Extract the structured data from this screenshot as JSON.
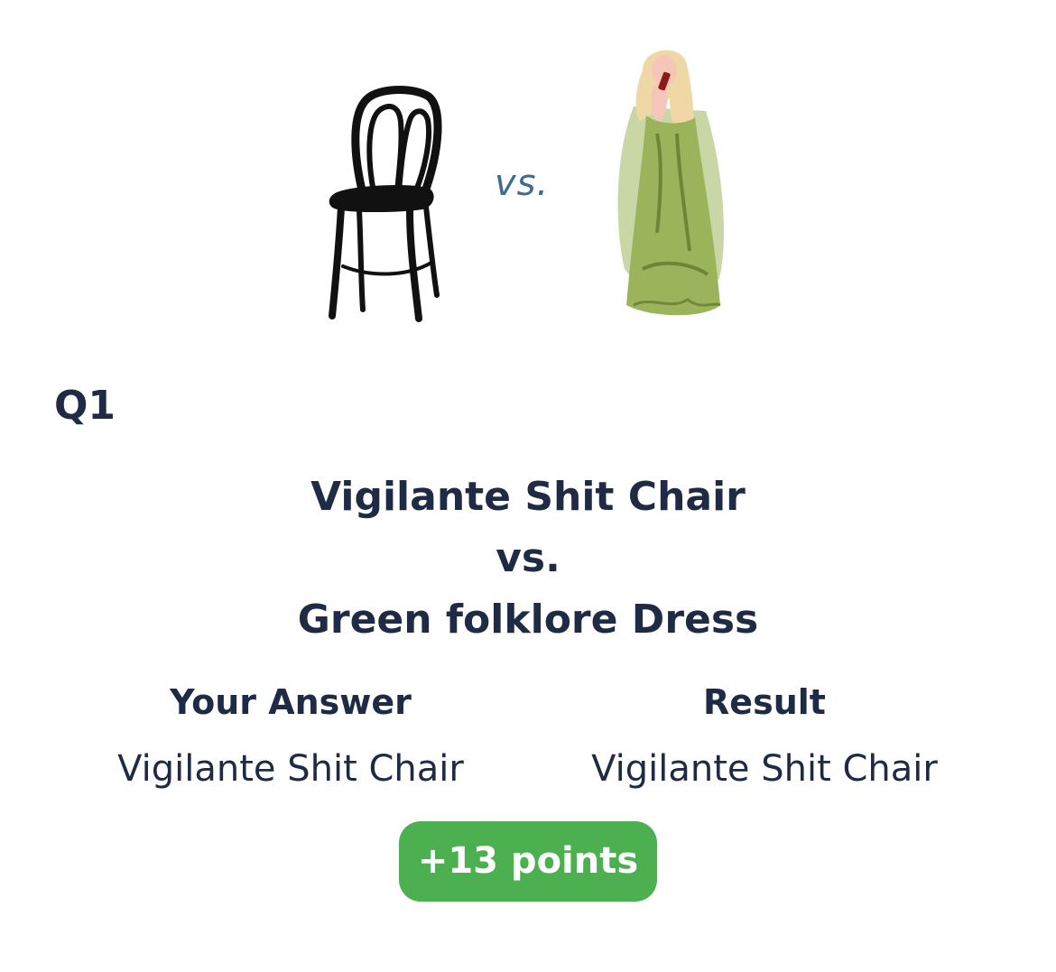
{
  "hero": {
    "left_image": "chair-image",
    "vs_label": "vs.",
    "right_image": "green-dress-image"
  },
  "question": {
    "number": "Q1",
    "option_a": "Vigilante Shit Chair",
    "vs_label": "vs.",
    "option_b": "Green folklore Dress"
  },
  "answer": {
    "your_answer_label": "Your Answer",
    "your_answer_value": "Vigilante Shit Chair",
    "result_label": "Result",
    "result_value": "Vigilante Shit Chair"
  },
  "score": {
    "label": "+13 points",
    "color": "#4caf50"
  },
  "colors": {
    "text": "#1f2a44",
    "vs_accent": "#3f6a92",
    "dress_green": "#9bb35a",
    "hair_blonde": "#f0d7a6"
  }
}
